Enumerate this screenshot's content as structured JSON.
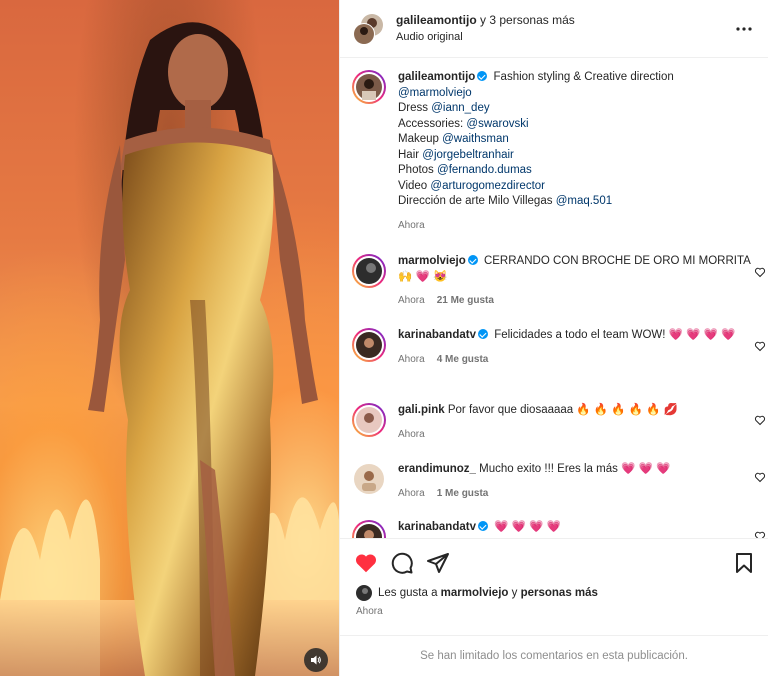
{
  "header": {
    "username": "galileamontijo",
    "others": "y 3 personas más",
    "audio": "Audio original"
  },
  "caption": {
    "username": "galileamontijo",
    "line1": "Fashion styling & Creative direction",
    "mention1": "@marmolviejo",
    "lines": [
      {
        "label": "Dress",
        "mention": "@iann_dey"
      },
      {
        "label": "Accessories:",
        "mention": "@swarovski"
      },
      {
        "label": "Makeup",
        "mention": "@waithsman"
      },
      {
        "label": "Hair",
        "mention": "@jorgebeltranhair"
      },
      {
        "label": "Photos",
        "mention": "@fernando.dumas"
      },
      {
        "label": "Video",
        "mention": "@arturogomezdirector"
      },
      {
        "label": "Dirección de arte Milo Villegas",
        "mention": "@maq.501"
      }
    ],
    "time": "Ahora"
  },
  "comments": [
    {
      "username": "marmolviejo",
      "verified": true,
      "text": "CERRANDO CON BROCHE DE ORO MI MORRITA 🙌 💗 😻",
      "time": "Ahora",
      "likes": "21 Me gusta"
    },
    {
      "username": "karinabandatv",
      "verified": true,
      "text": "Felicidades a todo el team WOW! 💗 💗 💗 💗",
      "time": "Ahora",
      "likes": "4 Me gusta"
    },
    {
      "username": "gali.pink",
      "verified": false,
      "text": "Por favor que diosaaaaa 🔥 🔥 🔥 🔥 🔥 💋",
      "time": "Ahora",
      "likes": ""
    },
    {
      "username": "erandimunoz_",
      "verified": false,
      "text": "Mucho exito !!! Eres la más 💗 💗 💗",
      "time": "Ahora",
      "likes": "1 Me gusta"
    },
    {
      "username": "karinabandatv",
      "verified": true,
      "text": "💗 💗 💗 💗",
      "time": "",
      "likes": ""
    }
  ],
  "liked_by": {
    "prefix": "Les gusta a",
    "user": "marmolviejo",
    "mid": "y",
    "rest": "personas más"
  },
  "post_time": "Ahora",
  "footer_text": "Se han limitado los comentarios en esta publicación.",
  "colors": {
    "like_red": "#ff3040",
    "mention": "#00376b",
    "verified": "#0095f6",
    "muted": "#737373"
  }
}
